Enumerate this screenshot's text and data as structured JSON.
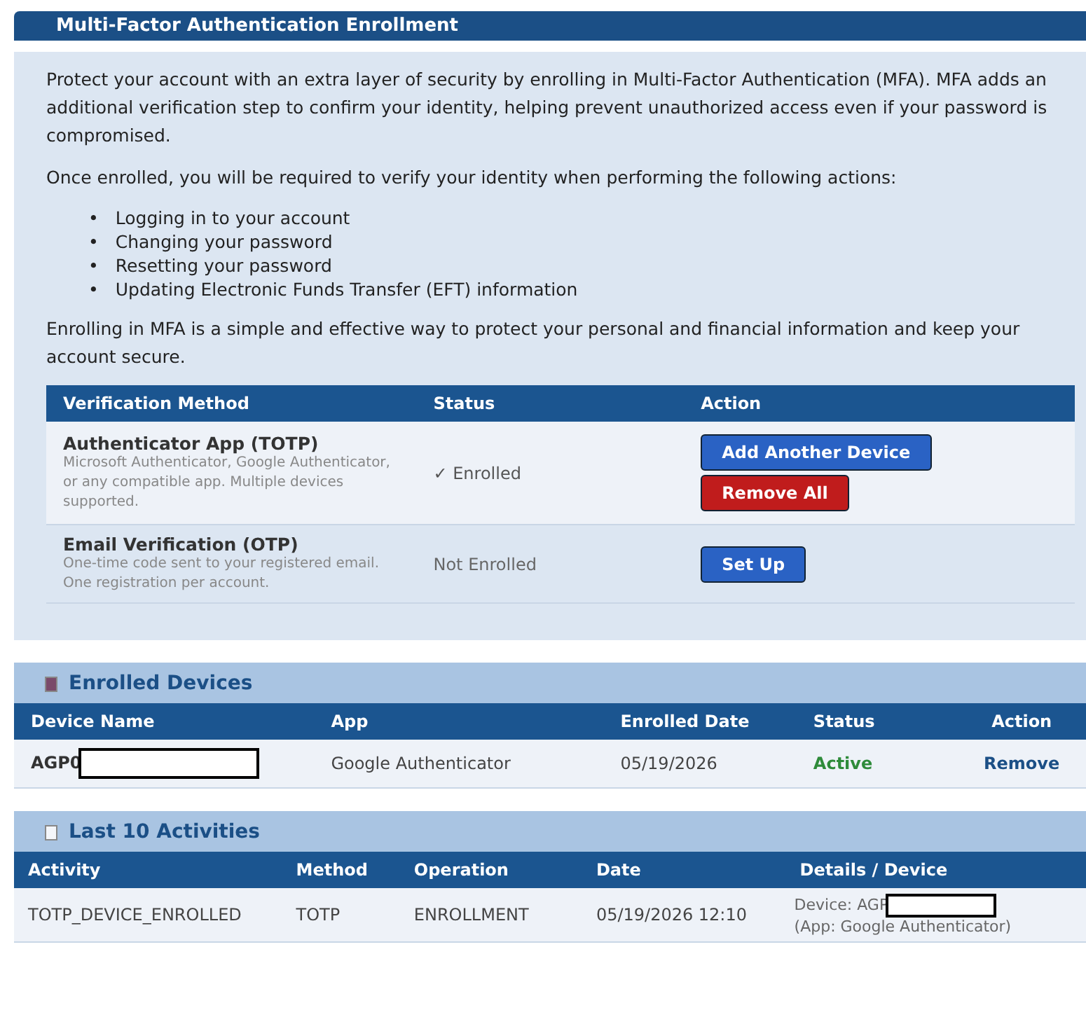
{
  "title": "Multi-Factor Authentication Enrollment",
  "intro": [
    "Protect your account with an extra layer of security by enrolling in Multi-Factor Authentication (MFA). MFA adds an additional verification step to confirm your identity, helping prevent unauthorized access even if your password is compromised.",
    "Once enrolled, you will be required to verify your identity when performing the following actions:"
  ],
  "actions_list": [
    {
      "bullet": "•",
      "text": "Logging in to your account"
    },
    {
      "bullet": "•",
      "text": "Changing your password"
    },
    {
      "bullet": "•",
      "text": "Resetting your password"
    },
    {
      "bullet": "•",
      "text": "Updating Electronic Funds Transfer (EFT) information"
    }
  ],
  "closing": "Enrolling in MFA is a simple and effective way to protect your personal and financial information and keep your account secure.",
  "methods": {
    "columns": [
      "Verification Method",
      "Status",
      "Action"
    ],
    "rows": [
      {
        "name": "Authenticator App (TOTP)",
        "description": "Microsoft Authenticator, Google Authenticator, or any compatible app. Multiple devices supported.",
        "status": "✓ Enrolled",
        "enrolled": true,
        "buttons": [
          {
            "label": "Add Another Device",
            "kind": "primary"
          },
          {
            "label": "Remove All",
            "kind": "danger"
          }
        ]
      },
      {
        "name": "Email Verification (OTP)",
        "description": "One-time code sent to your registered email. One registration per account.",
        "status": "Not Enrolled",
        "enrolled": false,
        "buttons": [
          {
            "label": "Set Up",
            "kind": "primary"
          }
        ]
      }
    ]
  },
  "devices": {
    "title": "Enrolled Devices",
    "columns": [
      "Device Name",
      "App",
      "Enrolled Date",
      "Status",
      "Action"
    ],
    "rows": [
      {
        "name": "AGP0",
        "redacted": true,
        "app": "Google Authenticator",
        "date": "05/19/2026",
        "status": "Active",
        "action": "Remove"
      }
    ]
  },
  "activities": {
    "title": "Last 10 Activities",
    "columns": [
      "Activity",
      "Method",
      "Operation",
      "Date",
      "Details / Device"
    ],
    "rows": [
      {
        "activity": "TOTP_DEVICE_ENROLLED",
        "method": "TOTP",
        "operation": "ENROLLMENT",
        "date": "05/19/2026 12:10",
        "details": [
          "Device: AGP",
          "(App: Google Authenticator)"
        ],
        "redacted": true
      }
    ]
  }
}
